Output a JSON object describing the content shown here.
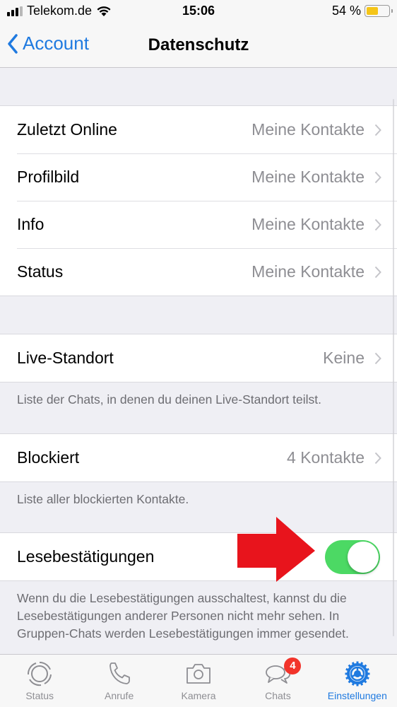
{
  "status_bar": {
    "carrier": "Telekom.de",
    "time": "15:06",
    "battery_percent_label": "54 %",
    "battery_level": 0.54,
    "battery_color": "#f5c518",
    "signal_bars_active": 3,
    "signal_bars_total": 4
  },
  "nav": {
    "back_label": "Account",
    "title": "Datenschutz",
    "accent_color": "#1f7ae0"
  },
  "sections": [
    {
      "rows": [
        {
          "label": "Zuletzt Online",
          "value": "Meine Kontakte"
        },
        {
          "label": "Profilbild",
          "value": "Meine Kontakte"
        },
        {
          "label": "Info",
          "value": "Meine Kontakte"
        },
        {
          "label": "Status",
          "value": "Meine Kontakte"
        }
      ]
    },
    {
      "rows": [
        {
          "label": "Live-Standort",
          "value": "Keine"
        }
      ],
      "footer": "Liste der Chats, in denen du deinen Live-Standort teilst."
    },
    {
      "rows": [
        {
          "label": "Blockiert",
          "value": "4 Kontakte"
        }
      ],
      "footer": "Liste aller blockierten Kontakte."
    },
    {
      "rows": [
        {
          "label": "Lesebestätigungen",
          "toggle": true
        }
      ],
      "footer": "Wenn du die Lesebestätigungen ausschaltest, kannst du die Lesebestätigungen anderer Personen nicht mehr sehen. In Gruppen-Chats werden Lesebestätigungen immer gesendet."
    }
  ],
  "annotation": {
    "type": "red-arrow",
    "points_to": "Lesebestätigungen toggle",
    "color": "#e8141c"
  },
  "tabbar": {
    "tabs": [
      {
        "label": "Status",
        "icon": "status-icon",
        "active": false
      },
      {
        "label": "Anrufe",
        "icon": "phone-icon",
        "active": false
      },
      {
        "label": "Kamera",
        "icon": "camera-icon",
        "active": false
      },
      {
        "label": "Chats",
        "icon": "chats-icon",
        "active": false,
        "badge": "4"
      },
      {
        "label": "Einstellungen",
        "icon": "settings-icon",
        "active": true
      }
    ],
    "badge_color": "#f2342b",
    "toggle_on_color": "#4cd964"
  }
}
